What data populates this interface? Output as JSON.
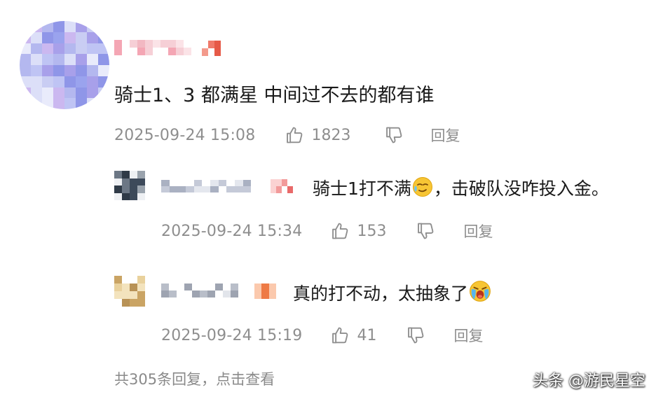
{
  "comment": {
    "text": "骑士1、3 都满星 中间过不去的都有谁",
    "time": "2025-09-24 15:08",
    "likes": "1823",
    "reply_label": "回复"
  },
  "replies": [
    {
      "text_before": "骑士1打不满",
      "emoji": "sweat-face-icon",
      "text_after": "，击破队没咋投入金。",
      "time": "2025-09-24 15:34",
      "likes": "153",
      "reply_label": "回复"
    },
    {
      "text_before": "真的打不动，太抽象了",
      "emoji": "crying-face-icon",
      "text_after": "",
      "time": "2025-09-24 15:19",
      "likes": "41",
      "reply_label": "回复"
    }
  ],
  "footer": {
    "view_replies": "共305条回复，点击查看"
  },
  "watermark": "头条 @游民星空",
  "colors": {
    "text": "#1a1a1a",
    "meta": "#8e8e8e",
    "background": "#ffffff"
  }
}
